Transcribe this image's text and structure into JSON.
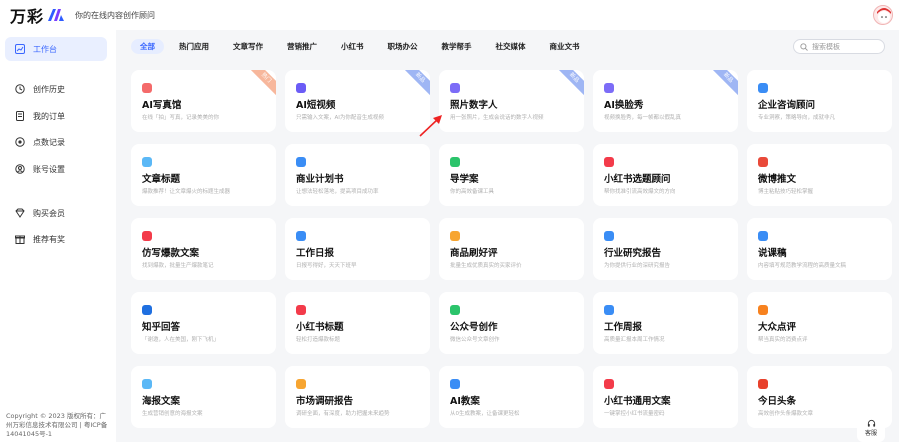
{
  "header": {
    "logo_text": "万彩",
    "slogan": "你的在线内容创作顾问"
  },
  "sidebar": {
    "items": [
      {
        "label": "工作台",
        "icon": "workbench-icon",
        "active": true
      },
      {
        "label": "创作历史",
        "icon": "history-icon"
      },
      {
        "label": "我的订单",
        "icon": "order-icon"
      },
      {
        "label": "点数记录",
        "icon": "points-icon"
      },
      {
        "label": "账号设置",
        "icon": "account-icon"
      },
      {
        "label": "购买会员",
        "icon": "vip-icon"
      },
      {
        "label": "推荐有奖",
        "icon": "gift-icon"
      }
    ],
    "copyright": "Copyright © 2023 版权所有：广州万彩信息技术有限公司 | 粤ICP备14041045号-1"
  },
  "tabs": [
    "全部",
    "热门应用",
    "文章写作",
    "营销推广",
    "小红书",
    "职场办公",
    "教学帮手",
    "社交媒体",
    "商业文书"
  ],
  "search": {
    "placeholder": "搜索模板"
  },
  "ribbons": {
    "hot": "热门",
    "new": "新品"
  },
  "cards": [
    {
      "title": "AI写真馆",
      "desc": "在线「拍」写真，记录美美的你",
      "icon_color": "#f46a6a",
      "ribbon": "hot"
    },
    {
      "title": "AI短视频",
      "desc": "只需输入文案，AI为你配音生成视频",
      "icon_color": "#6b5cf6",
      "ribbon": "new"
    },
    {
      "title": "照片数字人",
      "desc": "用一张照片，生成会说话的数字人视频",
      "icon_color": "#7c6cf7",
      "ribbon": "new"
    },
    {
      "title": "AI换脸秀",
      "desc": "视频换脸秀，每一帧都以假乱真",
      "icon_color": "#7c6cf7",
      "ribbon": "new"
    },
    {
      "title": "企业咨询顾问",
      "desc": "专业洞察，策略导向，成就非凡",
      "icon_color": "#3a8df5"
    },
    {
      "title": "文章标题",
      "desc": "爆款推荐！让文章爆火的标题生成器",
      "icon_color": "#5bb8f6"
    },
    {
      "title": "商业计划书",
      "desc": "让想法轻松落地，提高项目成功率",
      "icon_color": "#3a8df5"
    },
    {
      "title": "导学案",
      "desc": "你的高效备课工具",
      "icon_color": "#2bc46b"
    },
    {
      "title": "小红书选题顾问",
      "desc": "帮你找准引流高效爆文的方向",
      "icon_color": "#f33b4a"
    },
    {
      "title": "微博推文",
      "desc": "博主粘贴技巧轻松掌握",
      "icon_color": "#e94a3a"
    },
    {
      "title": "仿写爆款文案",
      "desc": "找到爆款，批量生产爆款笔记",
      "icon_color": "#f33b4a"
    },
    {
      "title": "工作日报",
      "desc": "日报写得好，天天下班早",
      "icon_color": "#3a8df5"
    },
    {
      "title": "商品刷好评",
      "desc": "批量生成优质真实的买家评价",
      "icon_color": "#f7a531"
    },
    {
      "title": "行业研究报告",
      "desc": "为你提供行业的深研究报告",
      "icon_color": "#3a8df5"
    },
    {
      "title": "说课稿",
      "desc": "内容填写规范教学流程的高质量文稿",
      "icon_color": "#3a8df5"
    },
    {
      "title": "知乎回答",
      "desc": "「谢邀，人在美国，刚下飞机」",
      "icon_color": "#1f6fe0"
    },
    {
      "title": "小红书标题",
      "desc": "轻松打造爆款标题",
      "icon_color": "#f33b4a"
    },
    {
      "title": "公众号创作",
      "desc": "微信公众号文章创作",
      "icon_color": "#2bc46b"
    },
    {
      "title": "工作周报",
      "desc": "高质量汇报本周工作情况",
      "icon_color": "#3a8df5"
    },
    {
      "title": "大众点评",
      "desc": "帮当真实的消费点评",
      "icon_color": "#f7821f"
    },
    {
      "title": "海报文案",
      "desc": "生成营销创意的海报文案",
      "icon_color": "#5bb8f6"
    },
    {
      "title": "市场调研报告",
      "desc": "调研全面，有深度，助力把握未来趋势",
      "icon_color": "#f7a531"
    },
    {
      "title": "AI教案",
      "desc": "从0生成教案，让备课更轻松",
      "icon_color": "#3a8df5"
    },
    {
      "title": "小红书通用文案",
      "desc": "一键掌控小红书流量密码",
      "icon_color": "#f33b4a"
    },
    {
      "title": "今日头条",
      "desc": "高效创作头条爆款文章",
      "icon_color": "#e8412c"
    }
  ],
  "service": {
    "label": "客服"
  },
  "colors": {
    "accent": "#3a67ff",
    "background": "#f5f6f8"
  }
}
